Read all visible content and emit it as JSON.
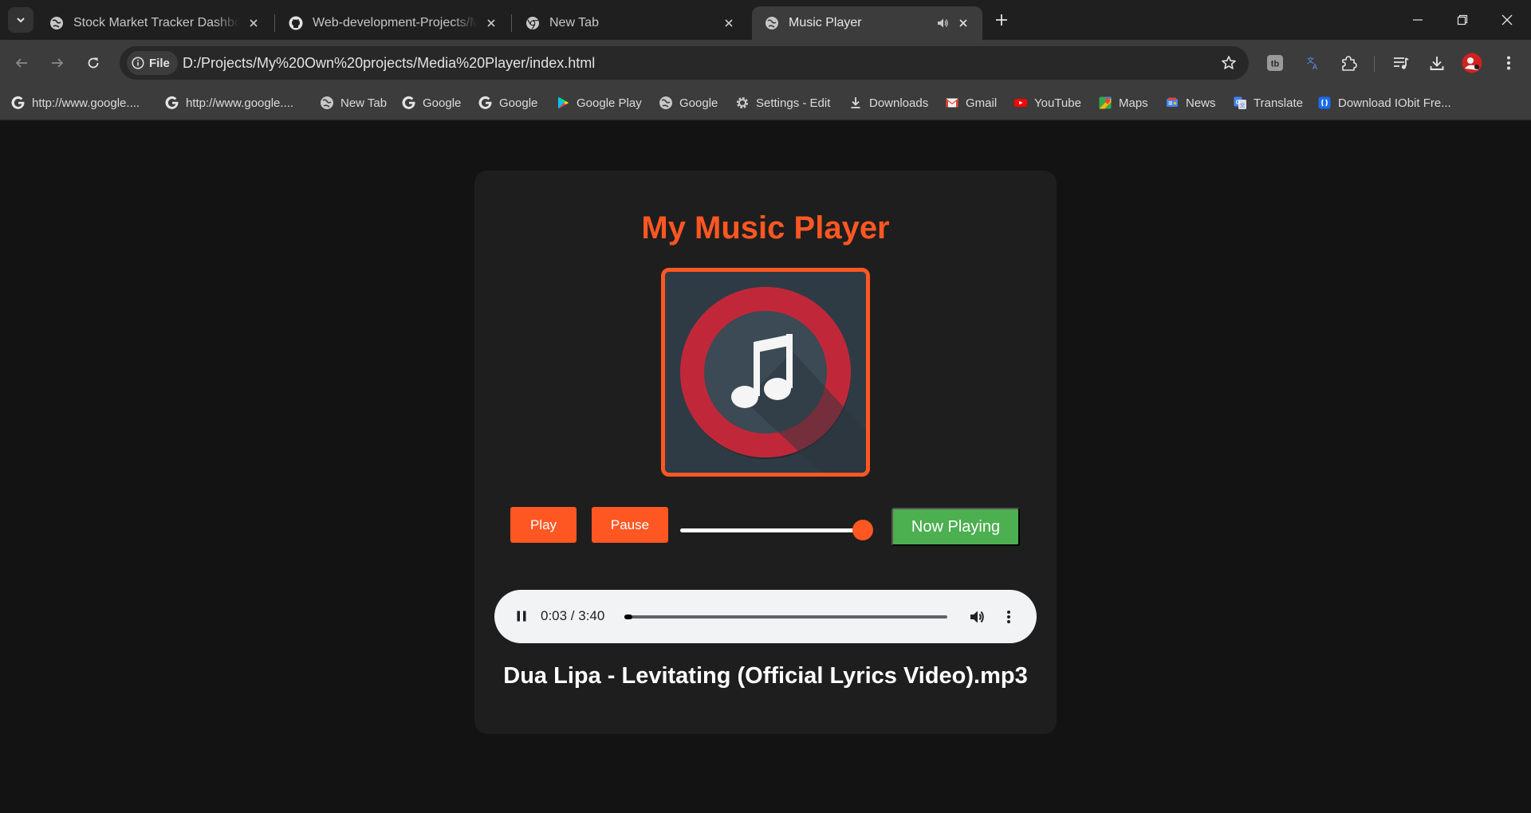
{
  "browser": {
    "tabs": [
      {
        "title": "Stock Market Tracker Dashboard",
        "icon": "globe-icon"
      },
      {
        "title": "Web-development-Projects/Media-Player",
        "icon": "github-icon"
      },
      {
        "title": "New Tab",
        "icon": "chrome-icon"
      },
      {
        "title": "Music Player",
        "icon": "globe-icon",
        "active": true,
        "audio": true
      }
    ],
    "address": {
      "chip_label": "File",
      "url": "D:/Projects/My%20Own%20projects/Media%20Player/index.html"
    },
    "bookmarks": [
      {
        "label": "http://www.google....",
        "icon": "google-icon"
      },
      {
        "label": "http://www.google....",
        "icon": "google-icon"
      },
      {
        "label": "New Tab",
        "icon": "globe-icon"
      },
      {
        "label": "Google",
        "icon": "google-icon"
      },
      {
        "label": "Google",
        "icon": "google-icon"
      },
      {
        "label": "Google Play",
        "icon": "google-play-icon"
      },
      {
        "label": "Google",
        "icon": "globe-icon"
      },
      {
        "label": "Settings - Edit",
        "icon": "gear-icon"
      },
      {
        "label": "Downloads",
        "icon": "download-icon"
      },
      {
        "label": "Gmail",
        "icon": "gmail-icon"
      },
      {
        "label": "YouTube",
        "icon": "youtube-icon"
      },
      {
        "label": "Maps",
        "icon": "maps-icon"
      },
      {
        "label": "News",
        "icon": "news-icon"
      },
      {
        "label": "Translate",
        "icon": "translate-icon"
      },
      {
        "label": "Download IObit Fre...",
        "icon": "iobit-icon"
      }
    ]
  },
  "player": {
    "title": "My Music Player",
    "play_label": "Play",
    "pause_label": "Pause",
    "now_playing_label": "Now Playing",
    "volume_level": 1.0,
    "audio": {
      "time": "0:03 / 3:40",
      "progress": 0.014
    },
    "track_name": "Dua Lipa - Levitating (Official Lyrics Video).mp3"
  },
  "colors": {
    "accent": "#ff5722",
    "now_playing": "#4caf50",
    "card_bg": "#1e1e1e",
    "page_bg": "#131313"
  }
}
